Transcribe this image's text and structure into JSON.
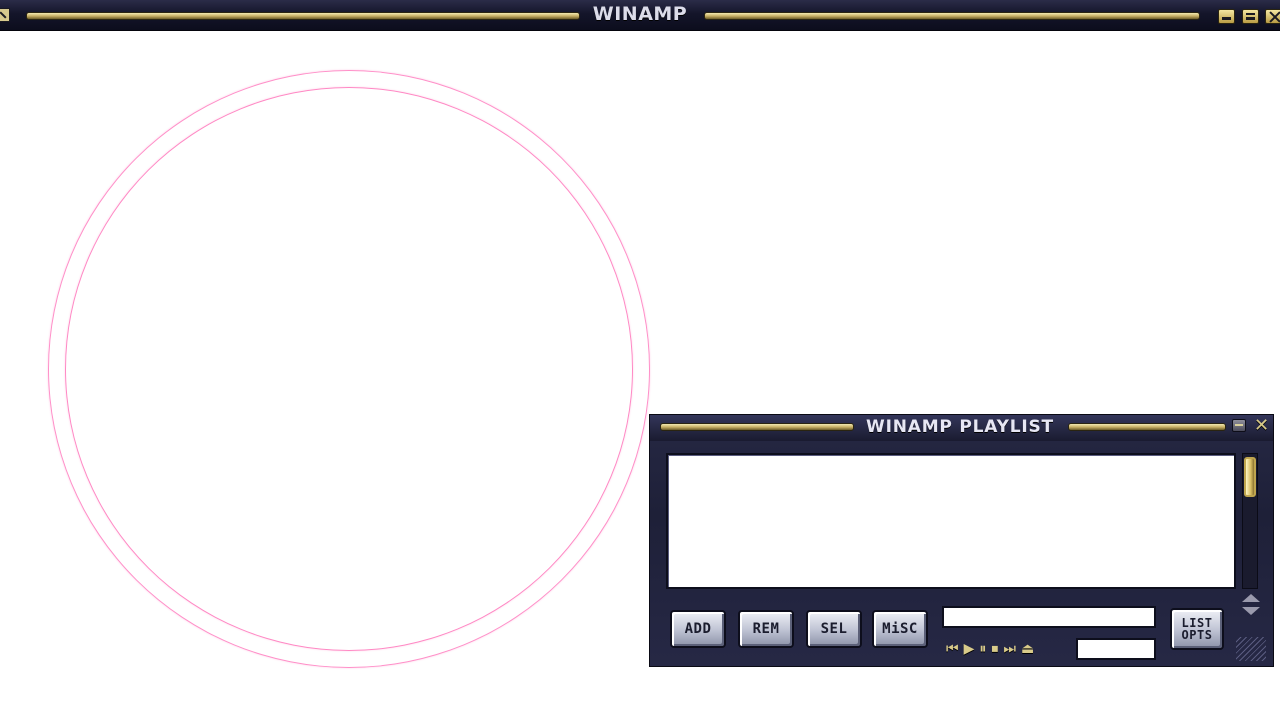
{
  "main_window": {
    "title": "WINAMP"
  },
  "playlist": {
    "title": "WINAMP PLAYLIST",
    "close_glyph": "✕",
    "buttons": {
      "add": "ADD",
      "rem": "REM",
      "sel": "SEL",
      "misc": "MiSC",
      "list_opts_line1": "LIST",
      "list_opts_line2": "OPTS"
    },
    "transport": {
      "prev": "⏮",
      "play": "▶",
      "pause": "⏸",
      "stop": "⏹",
      "next": "⏭",
      "eject": "⏏"
    }
  },
  "icons": {
    "title_left": "menu-icon",
    "title_buttons": [
      "minimize-icon",
      "shade-icon",
      "close-icon"
    ],
    "playlist_title_buttons": [
      "shade-icon",
      "close-icon"
    ]
  },
  "colors": {
    "frame_dark": "#1e2038",
    "gold_rail": "#c8b066",
    "ring_pink": "#ff88c4"
  }
}
